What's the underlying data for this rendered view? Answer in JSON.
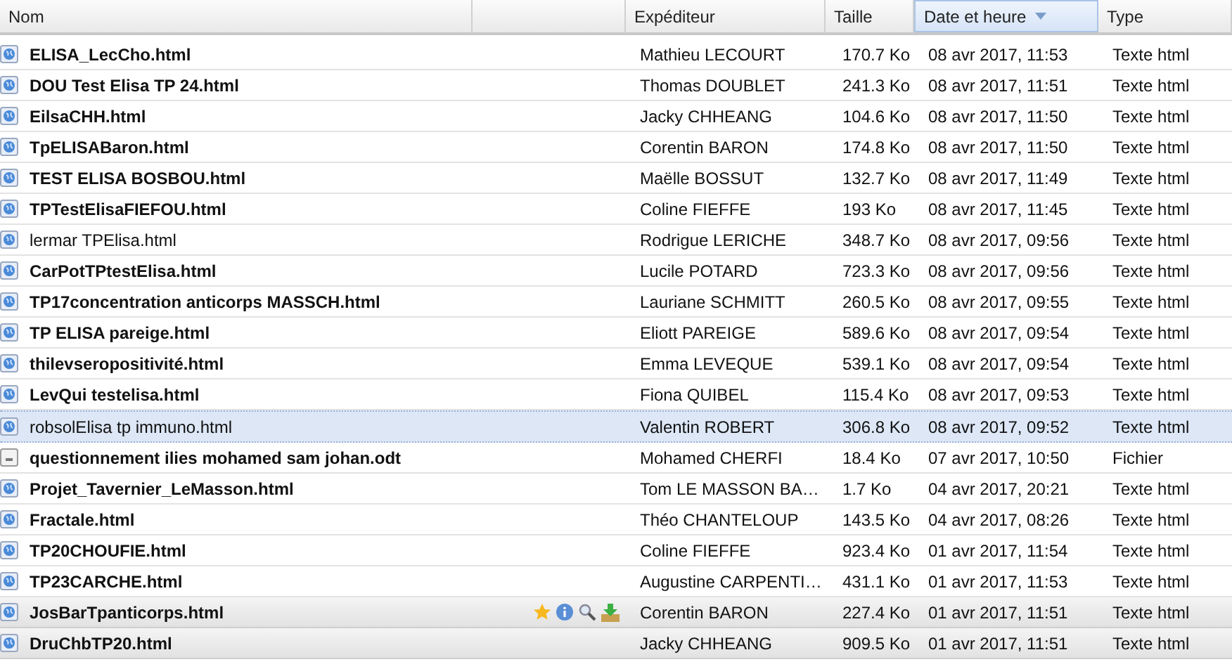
{
  "columns": [
    {
      "label": "Nom",
      "sorted": false
    },
    {
      "label": "Expéditeur",
      "sorted": false
    },
    {
      "label": "Taille",
      "sorted": false
    },
    {
      "label": "Date et heure",
      "sorted": true
    },
    {
      "label": "Type",
      "sorted": false
    }
  ],
  "rows": [
    {
      "kind": "html",
      "name": "ELISA_LecCho.html",
      "sender": "Mathieu LECOURT",
      "size": "170.7 Ko",
      "date": "08 avr 2017, 11:53",
      "type": "Texte html",
      "unread": true,
      "selected": false,
      "shaded": false,
      "show_actions": false
    },
    {
      "kind": "html",
      "name": "DOU Test Elisa TP 24.html",
      "sender": "Thomas DOUBLET",
      "size": "241.3 Ko",
      "date": "08 avr 2017, 11:51",
      "type": "Texte html",
      "unread": true,
      "selected": false,
      "shaded": false,
      "show_actions": false
    },
    {
      "kind": "html",
      "name": "EilsaCHH.html",
      "sender": "Jacky CHHEANG",
      "size": "104.6 Ko",
      "date": "08 avr 2017, 11:50",
      "type": "Texte html",
      "unread": true,
      "selected": false,
      "shaded": false,
      "show_actions": false
    },
    {
      "kind": "html",
      "name": "TpELISABaron.html",
      "sender": "Corentin BARON",
      "size": "174.8 Ko",
      "date": "08 avr 2017, 11:50",
      "type": "Texte html",
      "unread": true,
      "selected": false,
      "shaded": false,
      "show_actions": false
    },
    {
      "kind": "html",
      "name": "TEST ELISA BOSBOU.html",
      "sender": "Maëlle BOSSUT",
      "size": "132.7 Ko",
      "date": "08 avr 2017, 11:49",
      "type": "Texte html",
      "unread": true,
      "selected": false,
      "shaded": false,
      "show_actions": false
    },
    {
      "kind": "html",
      "name": "TPTestElisaFIEFOU.html",
      "sender": "Coline FIEFFE",
      "size": "193 Ko",
      "date": "08 avr 2017, 11:45",
      "type": "Texte html",
      "unread": true,
      "selected": false,
      "shaded": false,
      "show_actions": false
    },
    {
      "kind": "html",
      "name": "lermar TPElisa.html",
      "sender": "Rodrigue LERICHE",
      "size": "348.7 Ko",
      "date": "08 avr 2017, 09:56",
      "type": "Texte html",
      "unread": false,
      "selected": false,
      "shaded": false,
      "show_actions": false
    },
    {
      "kind": "html",
      "name": "CarPotTPtestElisa.html",
      "sender": "Lucile POTARD",
      "size": "723.3 Ko",
      "date": "08 avr 2017, 09:56",
      "type": "Texte html",
      "unread": true,
      "selected": false,
      "shaded": false,
      "show_actions": false
    },
    {
      "kind": "html",
      "name": "TP17concentration anticorps MASSCH.html",
      "sender": "Lauriane SCHMITT",
      "size": "260.5 Ko",
      "date": "08 avr 2017, 09:55",
      "type": "Texte html",
      "unread": true,
      "selected": false,
      "shaded": false,
      "show_actions": false
    },
    {
      "kind": "html",
      "name": "TP ELISA pareige.html",
      "sender": "Eliott PAREIGE",
      "size": "589.6 Ko",
      "date": "08 avr 2017, 09:54",
      "type": "Texte html",
      "unread": true,
      "selected": false,
      "shaded": false,
      "show_actions": false
    },
    {
      "kind": "html",
      "name": "thilevseropositivité.html",
      "sender": "Emma LEVEQUE",
      "size": "539.1 Ko",
      "date": "08 avr 2017, 09:54",
      "type": "Texte html",
      "unread": true,
      "selected": false,
      "shaded": false,
      "show_actions": false
    },
    {
      "kind": "html",
      "name": "LevQui testelisa.html",
      "sender": "Fiona QUIBEL",
      "size": "115.4 Ko",
      "date": "08 avr 2017, 09:53",
      "type": "Texte html",
      "unread": true,
      "selected": false,
      "shaded": false,
      "show_actions": false
    },
    {
      "kind": "html",
      "name": "robsolElisa tp immuno.html",
      "sender": "Valentin ROBERT",
      "size": "306.8 Ko",
      "date": "08 avr 2017, 09:52",
      "type": "Texte html",
      "unread": false,
      "selected": true,
      "shaded": false,
      "show_actions": false
    },
    {
      "kind": "file",
      "name": "questionnement ilies mohamed sam johan.odt",
      "sender": "Mohamed CHERFI",
      "size": "18.4 Ko",
      "date": "07 avr 2017, 10:50",
      "type": "Fichier",
      "unread": true,
      "selected": false,
      "shaded": false,
      "show_actions": false
    },
    {
      "kind": "html",
      "name": "Projet_Tavernier_LeMasson.html",
      "sender": "Tom LE MASSON BA…",
      "size": "1.7 Ko",
      "date": "04 avr 2017, 20:21",
      "type": "Texte html",
      "unread": true,
      "selected": false,
      "shaded": false,
      "show_actions": false
    },
    {
      "kind": "html",
      "name": "Fractale.html",
      "sender": "Théo CHANTELOUP",
      "size": "143.5 Ko",
      "date": "04 avr 2017, 08:26",
      "type": "Texte html",
      "unread": true,
      "selected": false,
      "shaded": false,
      "show_actions": false
    },
    {
      "kind": "html",
      "name": "TP20CHOUFIE.html",
      "sender": "Coline FIEFFE",
      "size": "923.4 Ko",
      "date": "01 avr 2017, 11:54",
      "type": "Texte html",
      "unread": true,
      "selected": false,
      "shaded": false,
      "show_actions": false
    },
    {
      "kind": "html",
      "name": "TP23CARCHE.html",
      "sender": "Augustine CARPENTI…",
      "size": "431.1 Ko",
      "date": "01 avr 2017, 11:53",
      "type": "Texte html",
      "unread": true,
      "selected": false,
      "shaded": false,
      "show_actions": false
    },
    {
      "kind": "html",
      "name": "JosBarTpanticorps.html",
      "sender": "Corentin BARON",
      "size": "227.4 Ko",
      "date": "01 avr 2017, 11:51",
      "type": "Texte html",
      "unread": true,
      "selected": false,
      "shaded": true,
      "show_actions": true
    },
    {
      "kind": "html",
      "name": "DruChbTP20.html",
      "sender": "Jacky CHHEANG",
      "size": "909.5 Ko",
      "date": "01 avr 2017, 11:51",
      "type": "Texte html",
      "unread": true,
      "selected": false,
      "shaded": true,
      "show_actions": false
    }
  ]
}
